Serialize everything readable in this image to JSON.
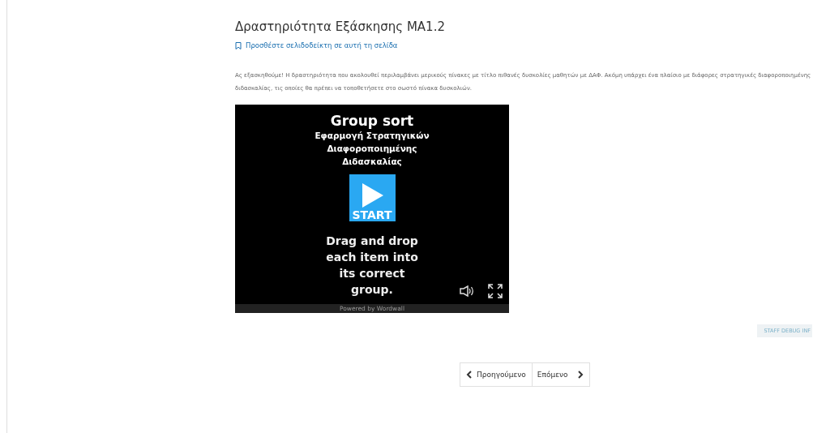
{
  "page": {
    "title": "Δραστηριότητα Εξάσκησης ΜΑ1.2",
    "bookmark_link": "Προσθέστε σελιδοδείκτη σε αυτή τη σελίδα",
    "intro": "Ας εξασκηθούμε! Η δραστηριότητα που ακολουθεί περιλαμβάνει μερικούς πίνακες με τίτλο πιθανές δυσκολίες μαθητών με ΔΑΦ. Ακόμη υπάρχει ένα πλαίσιο με διάφορες στρατηγικές διαφοροποιημένης διδασκαλίας, τις οποίες θα πρέπει να τοποθετήσετε στο σωστό πίνακα δυσκολιών."
  },
  "game": {
    "title": "Group sort",
    "subtitle": "Εφαρμογή Στρατηγικών Διαφοροποιημένης Διδασκαλίας",
    "start_label": "START",
    "instructions": "Drag and drop each item into its correct group.",
    "footer": "Powered by Wordwall"
  },
  "debug_button": "STAFF DEBUG INF",
  "navigation": {
    "previous": "Προηγούμενο",
    "next": "Επόμενο"
  }
}
